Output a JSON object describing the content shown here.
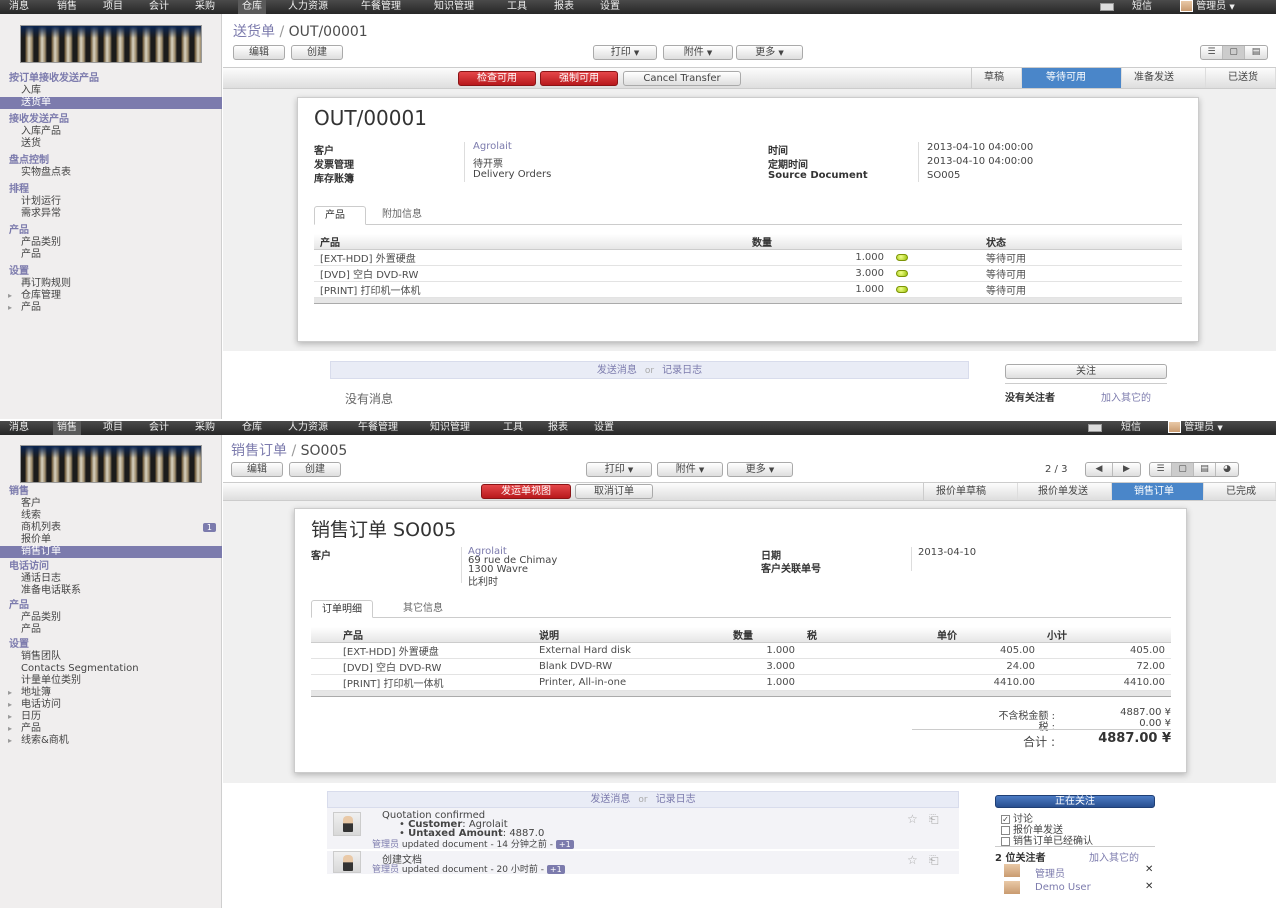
{
  "top": {
    "menu": [
      "消息",
      "销售",
      "项目",
      "会计",
      "采购",
      "仓库",
      "人力资源",
      "午餐管理",
      "知识管理",
      "工具",
      "报表",
      "设置"
    ],
    "active": "仓库",
    "messages": "短信",
    "user": "管理员"
  },
  "top_sidebar": {
    "sections": [
      {
        "title": "按订单接收发送产品",
        "items": [
          {
            "label": "入库"
          },
          {
            "label": "送货单",
            "selected": true
          }
        ]
      },
      {
        "title": "接收发送产品",
        "items": [
          {
            "label": "入库产品"
          },
          {
            "label": "送货"
          }
        ]
      },
      {
        "title": "盘点控制",
        "items": [
          {
            "label": "实物盘点表"
          }
        ]
      },
      {
        "title": "排程",
        "items": [
          {
            "label": "计划运行"
          },
          {
            "label": "需求异常"
          }
        ]
      },
      {
        "title": "产品",
        "items": [
          {
            "label": "产品类别"
          },
          {
            "label": "产品"
          }
        ]
      },
      {
        "title": "设置",
        "items": [
          {
            "label": "再订购规则"
          },
          {
            "label": "仓库管理",
            "sub": true
          },
          {
            "label": "产品",
            "sub": true
          }
        ]
      }
    ]
  },
  "top_main": {
    "breadcrumb_link": "送货单",
    "breadcrumb_sep": "/",
    "breadcrumb_current": "OUT/00001",
    "edit": "编辑",
    "create": "创建",
    "print": "打印",
    "attach": "附件",
    "more": "更多",
    "actions": [
      "检查可用",
      "强制可用",
      "Cancel Transfer"
    ],
    "steps": [
      {
        "label": "草稿"
      },
      {
        "label": "等待可用",
        "active": true
      },
      {
        "label": "准备发送"
      },
      {
        "label": "已送货"
      }
    ],
    "title": "OUT/00001",
    "fields_left": [
      {
        "label": "客户",
        "value": "Agrolait",
        "link": true
      },
      {
        "label": "发票管理",
        "value": "待开票"
      },
      {
        "label": "库存账簿",
        "value": "Delivery Orders"
      }
    ],
    "fields_right": [
      {
        "label": "时间",
        "value": "2013-04-10 04:00:00"
      },
      {
        "label": "定期时间",
        "value": "2013-04-10 04:00:00"
      },
      {
        "label": "Source Document",
        "value": "SO005"
      }
    ],
    "tabs": [
      "产品",
      "附加信息"
    ],
    "table": {
      "headers": [
        "产品",
        "数量",
        "状态"
      ],
      "rows": [
        {
          "product": "[EXT-HDD] 外置硬盘",
          "qty": "1.000",
          "status": "等待可用"
        },
        {
          "product": "[DVD] 空白 DVD-RW",
          "qty": "3.000",
          "status": "等待可用"
        },
        {
          "product": "[PRINT] 打印机一体机",
          "qty": "1.000",
          "status": "等待可用"
        }
      ]
    },
    "chatter": {
      "send": "发送消息",
      "or": "or",
      "log": "记录日志",
      "empty": "没有消息",
      "follow": "关注",
      "no_followers": "没有关注者",
      "add_others": "加入其它的"
    }
  },
  "bottom_sidebar": {
    "sections": [
      {
        "title": "销售",
        "items": [
          {
            "label": "客户"
          },
          {
            "label": "线索"
          },
          {
            "label": "商机列表",
            "badge": "1"
          },
          {
            "label": "报价单"
          },
          {
            "label": "销售订单",
            "selected": true
          }
        ]
      },
      {
        "title": "电话访问",
        "items": [
          {
            "label": "通话日志"
          },
          {
            "label": "准备电话联系"
          }
        ]
      },
      {
        "title": "产品",
        "items": [
          {
            "label": "产品类别"
          },
          {
            "label": "产品"
          }
        ]
      },
      {
        "title": "设置",
        "items": [
          {
            "label": "销售团队"
          },
          {
            "label": "Contacts Segmentation"
          },
          {
            "label": "计量单位类别"
          },
          {
            "label": "地址簿",
            "sub": true
          },
          {
            "label": "电话访问",
            "sub": true
          },
          {
            "label": "日历",
            "sub": true
          },
          {
            "label": "产品",
            "sub": true
          },
          {
            "label": "线索&商机",
            "sub": true
          }
        ]
      }
    ]
  },
  "bottom_main": {
    "breadcrumb_link": "销售订单",
    "breadcrumb_sep": "/",
    "breadcrumb_current": "SO005",
    "edit": "编辑",
    "create": "创建",
    "print": "打印",
    "attach": "附件",
    "more": "更多",
    "pager": "2 / 3",
    "actions": [
      "发运单视图",
      "取消订单"
    ],
    "steps": [
      {
        "label": "报价单草稿"
      },
      {
        "label": "报价单发送"
      },
      {
        "label": "销售订单",
        "active": true
      },
      {
        "label": "已完成"
      }
    ],
    "title": "销售订单 SO005",
    "customer_label": "客户",
    "customer_name": "Agrolait",
    "address": [
      "69 rue de Chimay",
      "1300 Wavre",
      "比利时"
    ],
    "date_label": "日期",
    "date_value": "2013-04-10",
    "ref_label": "客户关联单号",
    "tabs": [
      "订单明细",
      "其它信息"
    ],
    "table": {
      "headers": [
        "产品",
        "说明",
        "数量",
        "税",
        "单价",
        "小计"
      ],
      "rows": [
        {
          "product": "[EXT-HDD] 外置硬盘",
          "desc": "External Hard disk",
          "qty": "1.000",
          "tax": "",
          "price": "405.00",
          "subtotal": "405.00"
        },
        {
          "product": "[DVD] 空白 DVD-RW",
          "desc": "Blank DVD-RW",
          "qty": "3.000",
          "tax": "",
          "price": "24.00",
          "subtotal": "72.00"
        },
        {
          "product": "[PRINT] 打印机一体机",
          "desc": "Printer, All-in-one",
          "qty": "1.000",
          "tax": "",
          "price": "4410.00",
          "subtotal": "4410.00"
        }
      ]
    },
    "totals": {
      "untaxed_label": "不含税金额 :",
      "untaxed": "4887.00 ¥",
      "tax_label": "税 :",
      "tax": "0.00 ¥",
      "total_label": "合计 :",
      "total": "4887.00 ¥"
    },
    "chatter": {
      "send": "发送消息",
      "or": "or",
      "log": "记录日志",
      "messages": [
        {
          "title": "Quotation confirmed",
          "customer_key": "Customer",
          "customer_val": ": Agrolait",
          "amount_key": "Untaxed Amount",
          "amount_val": ": 4887.0",
          "author": "管理员",
          "meta": "updated document - 14 分钟之前 -",
          "plus": "+1"
        },
        {
          "title": "创建文档",
          "author": "管理员",
          "meta": "updated document - 20 小时前 -",
          "plus": "+1"
        }
      ],
      "following": "正在关注",
      "subs": [
        {
          "label": "讨论",
          "checked": true
        },
        {
          "label": "报价单发送",
          "checked": false
        },
        {
          "label": "销售订单已经确认",
          "checked": false
        }
      ],
      "followers_count": "2 位关注者",
      "add_others": "加入其它的",
      "followers": [
        "管理员",
        "Demo User"
      ]
    }
  }
}
